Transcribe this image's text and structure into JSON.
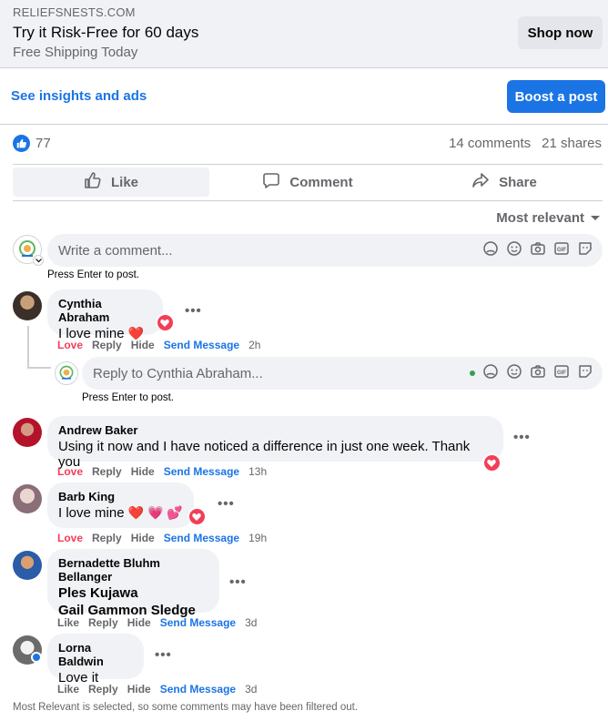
{
  "ad": {
    "domain": "RELIEFSNESTS.COM",
    "title": "Try it Risk-Free for 60 days",
    "subtitle": "Free Shipping Today",
    "cta": "Shop now"
  },
  "post_tools": {
    "insights_link": "See insights and ads",
    "boost_button": "Boost a post"
  },
  "stats": {
    "reaction_count": "77",
    "comments": "14 comments",
    "shares": "21 shares"
  },
  "actions": {
    "like": "Like",
    "comment": "Comment",
    "share": "Share"
  },
  "sort": {
    "label": "Most relevant"
  },
  "composer": {
    "placeholder": "Write a comment...",
    "hint": "Press Enter to post."
  },
  "icons": {
    "reaction": "like-thumb-icon",
    "like": "thumbs-up-icon",
    "comment": "speech-bubble-icon",
    "share": "share-arrow-icon",
    "sort": "caret-down-icon",
    "composer": [
      "avatar-sticker-icon",
      "emoji-icon",
      "camera-icon",
      "gif-icon",
      "sticker-icon"
    ],
    "love_badge": "heart-icon",
    "more": "ellipsis-icon"
  },
  "colors": {
    "accent": "#1b74e4",
    "love": "#f33e58",
    "surface": "#f0f2f5",
    "muted": "#65676b"
  },
  "comments": [
    {
      "name": "Cynthia Abraham",
      "text": "I love mine",
      "emoji": "❤️",
      "reaction": "love",
      "actions": {
        "react": "Love",
        "reply": "Reply",
        "hide": "Hide",
        "send": "Send Message",
        "time": "2h"
      },
      "reply_box": {
        "placeholder": "Reply to Cynthia Abraham...",
        "hint": "Press Enter to post."
      }
    },
    {
      "name": "Andrew Baker",
      "text": "Using it now and I have noticed a difference in just one week. Thank you",
      "actions": {
        "react": "Love",
        "reply": "Reply",
        "hide": "Hide",
        "send": "Send Message",
        "time": "13h"
      }
    },
    {
      "name": "Barb King",
      "text": "I love mine",
      "emoji": "❤️ 💗 💕",
      "actions": {
        "react": "Love",
        "reply": "Reply",
        "hide": "Hide",
        "send": "Send Message",
        "time": "19h"
      }
    },
    {
      "name": "Bernadette Bluhm Bellanger",
      "tags": [
        "Ples Kujawa",
        "Gail Gammon Sledge"
      ],
      "actions": {
        "react": "Like",
        "reply": "Reply",
        "hide": "Hide",
        "send": "Send Message",
        "time": "3d"
      }
    },
    {
      "name": "Lorna Baldwin",
      "text": "Love it",
      "actions": {
        "react": "Like",
        "reply": "Reply",
        "hide": "Hide",
        "send": "Send Message",
        "time": "3d"
      }
    }
  ],
  "footer": "Most Relevant is selected, so some comments may have been filtered out."
}
